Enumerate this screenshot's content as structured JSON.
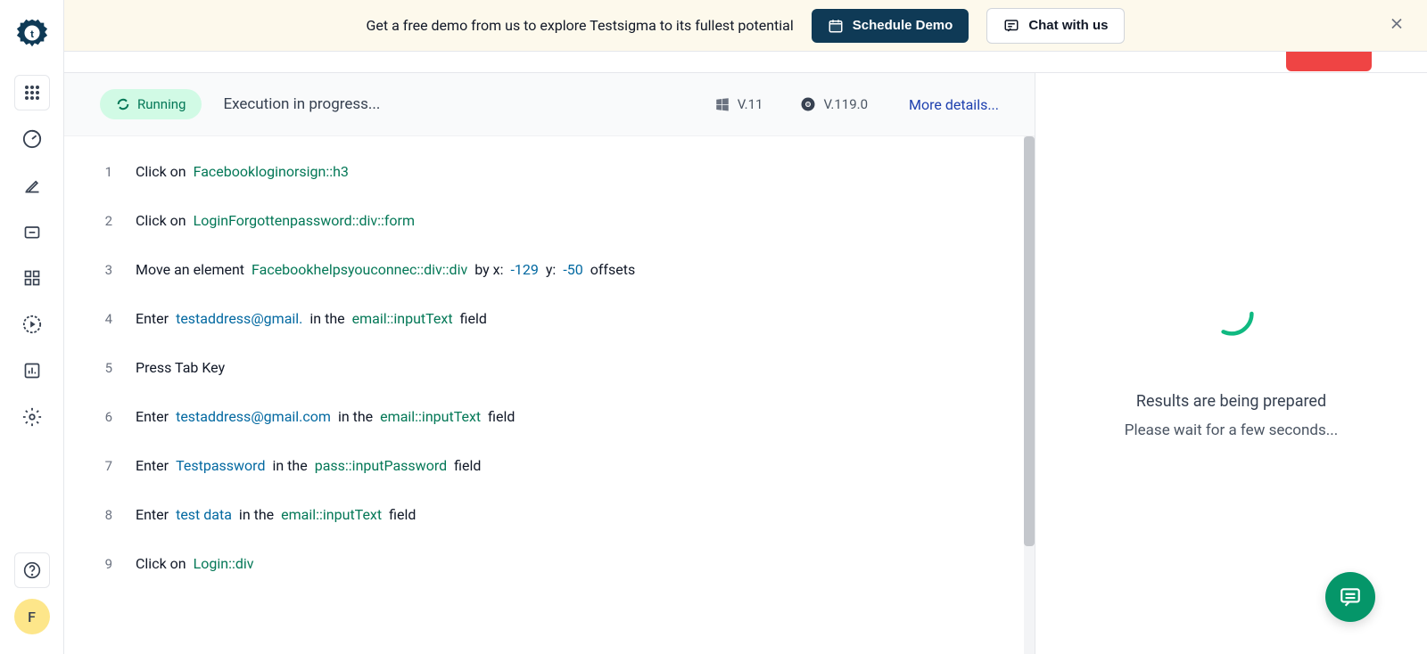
{
  "sidebar": {
    "avatar_letter": "F"
  },
  "banner": {
    "text": "Get a free demo from us to explore Testsigma to its fullest potential",
    "schedule_label": "Schedule Demo",
    "chat_label": "Chat with us"
  },
  "execution": {
    "status": "Running",
    "message": "Execution in progress...",
    "os_version": "V.11",
    "browser_version": "V.119.0",
    "more_details": "More details..."
  },
  "steps": [
    {
      "num": "1",
      "segments": [
        {
          "t": "Click on",
          "c": ""
        },
        {
          "t": "Facebookloginorsign::h3",
          "c": "green"
        }
      ]
    },
    {
      "num": "2",
      "segments": [
        {
          "t": "Click on",
          "c": ""
        },
        {
          "t": "LoginForgottenpassword::div::form",
          "c": "green"
        }
      ]
    },
    {
      "num": "3",
      "segments": [
        {
          "t": "Move an element",
          "c": ""
        },
        {
          "t": "Facebookhelpsyouconnec::div::div",
          "c": "green"
        },
        {
          "t": "by x:",
          "c": ""
        },
        {
          "t": "-129",
          "c": "link"
        },
        {
          "t": "y:",
          "c": ""
        },
        {
          "t": "-50",
          "c": "link"
        },
        {
          "t": "offsets",
          "c": ""
        }
      ]
    },
    {
      "num": "4",
      "segments": [
        {
          "t": "Enter",
          "c": ""
        },
        {
          "t": "testaddress@gmail.",
          "c": "link"
        },
        {
          "t": "in the",
          "c": ""
        },
        {
          "t": "email::inputText",
          "c": "green"
        },
        {
          "t": "field",
          "c": ""
        }
      ]
    },
    {
      "num": "5",
      "segments": [
        {
          "t": "Press Tab Key",
          "c": ""
        }
      ]
    },
    {
      "num": "6",
      "segments": [
        {
          "t": "Enter",
          "c": ""
        },
        {
          "t": "testaddress@gmail.com",
          "c": "link"
        },
        {
          "t": "in the",
          "c": ""
        },
        {
          "t": "email::inputText",
          "c": "green"
        },
        {
          "t": "field",
          "c": ""
        }
      ]
    },
    {
      "num": "7",
      "segments": [
        {
          "t": "Enter",
          "c": ""
        },
        {
          "t": "Testpassword",
          "c": "link"
        },
        {
          "t": "in the",
          "c": ""
        },
        {
          "t": "pass::inputPassword",
          "c": "green"
        },
        {
          "t": "field",
          "c": ""
        }
      ]
    },
    {
      "num": "8",
      "segments": [
        {
          "t": "Enter",
          "c": ""
        },
        {
          "t": "test data",
          "c": "link"
        },
        {
          "t": "in the",
          "c": ""
        },
        {
          "t": "email::inputText",
          "c": "green"
        },
        {
          "t": "field",
          "c": ""
        }
      ]
    },
    {
      "num": "9",
      "segments": [
        {
          "t": "Click on",
          "c": ""
        },
        {
          "t": "Login::div",
          "c": "green"
        }
      ]
    }
  ],
  "results": {
    "line1": "Results are being prepared",
    "line2": "Please wait for a few seconds..."
  }
}
